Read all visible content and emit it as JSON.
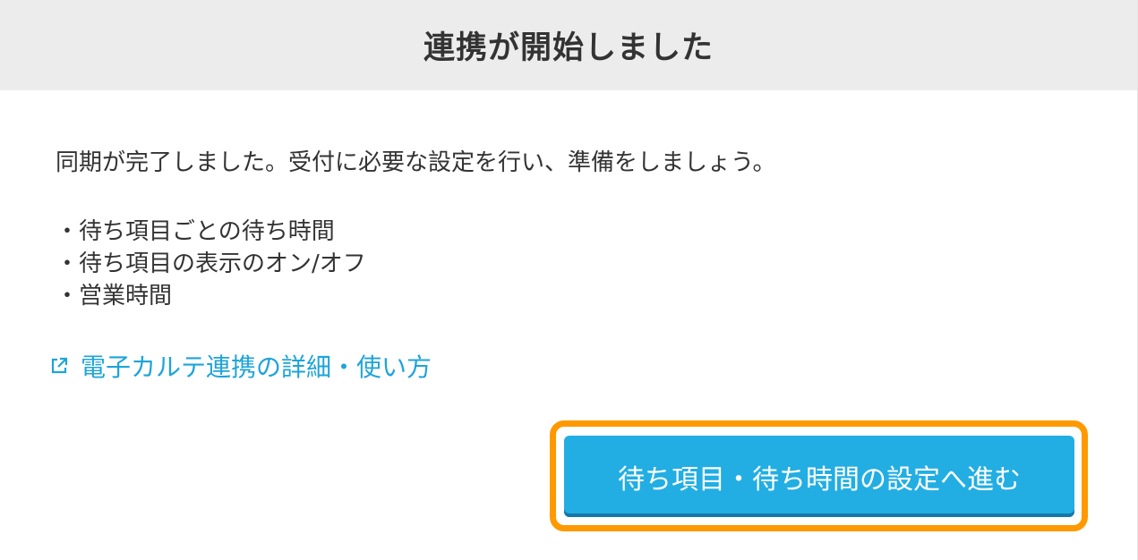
{
  "dialog": {
    "title": "連携が開始しました",
    "intro": "同期が完了しました。受付に必要な設定を行い、準備をしましょう。",
    "settings_items": [
      "・待ち項目ごとの待ち時間",
      "・待ち項目の表示のオン/オフ",
      "・営業時間"
    ],
    "help_link": {
      "icon": "external-link-icon",
      "label": "電子カルテ連携の詳細・使い方"
    },
    "primary_button_label": "待ち項目・待ち時間の設定へ進む",
    "colors": {
      "header_bg": "#ececec",
      "link": "#1ea4d9",
      "button": "#22aee3",
      "highlight": "#ff9900"
    }
  }
}
